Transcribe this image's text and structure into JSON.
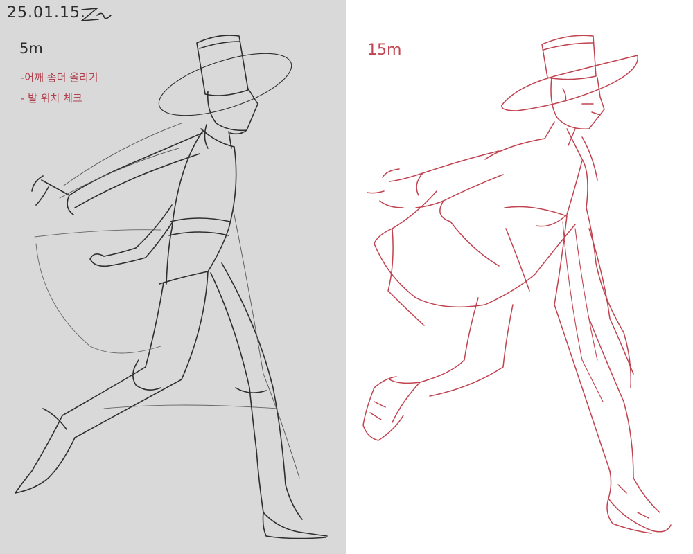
{
  "left_panel": {
    "date": "25.01.15.",
    "time": "5m",
    "notes": [
      "-어깨 좀더 올리기",
      "- 발 위치 체크"
    ]
  },
  "right_panel": {
    "time": "15m"
  },
  "colors": {
    "left_background": "#d9d9d9",
    "right_background": "#ffffff",
    "sketch_ink": "#2b2b2b",
    "note_ink": "#b0404d",
    "clean_ink": "#c0434f"
  }
}
